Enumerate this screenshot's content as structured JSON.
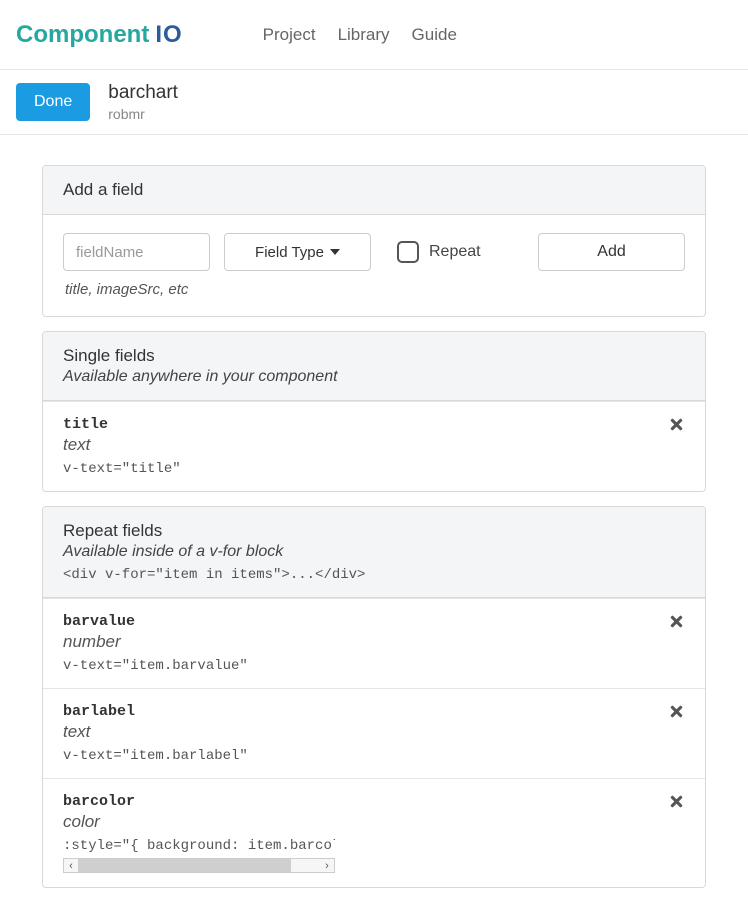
{
  "brand": {
    "part1": "Component",
    "part2": "IO"
  },
  "nav": {
    "project": "Project",
    "library": "Library",
    "guide": "Guide"
  },
  "header": {
    "done": "Done",
    "title": "barchart",
    "owner": "robmr"
  },
  "addfield": {
    "title": "Add a field",
    "placeholder": "fieldName",
    "typeLabel": "Field Type",
    "repeatLabel": "Repeat",
    "addLabel": "Add",
    "hint": "title, imageSrc, etc"
  },
  "single": {
    "title": "Single fields",
    "subtitle": "Available anywhere in your component",
    "fields": [
      {
        "name": "title",
        "type": "text",
        "binding": "v-text=\"title\""
      }
    ]
  },
  "repeat": {
    "title": "Repeat fields",
    "subtitle": "Available inside of a v-for block",
    "example": "<div v-for=\"item in items\">...</div>",
    "fields": [
      {
        "name": "barvalue",
        "type": "number",
        "binding": "v-text=\"item.barvalue\""
      },
      {
        "name": "barlabel",
        "type": "text",
        "binding": "v-text=\"item.barlabel\""
      },
      {
        "name": "barcolor",
        "type": "color",
        "binding": ":style=\"{ background: item.barcolor }\""
      }
    ]
  }
}
